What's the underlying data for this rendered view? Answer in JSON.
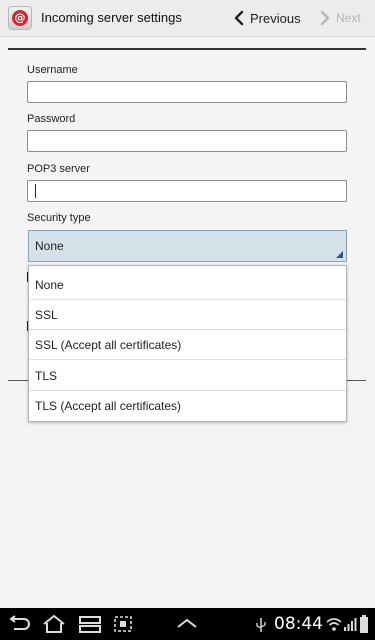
{
  "header": {
    "app_icon_glyph": "@",
    "title": "Incoming server settings",
    "previous_label": "Previous",
    "next_label": "Next"
  },
  "form": {
    "username_label": "Username",
    "username_value": "",
    "password_label": "Password",
    "password_value": "",
    "pop3_label": "POP3 server",
    "pop3_value": "",
    "security_label": "Security type",
    "security_value": "None"
  },
  "dropdown": {
    "options": [
      "None",
      "SSL",
      "SSL (Accept all certificates)",
      "TLS",
      "TLS (Accept all certificates)"
    ]
  },
  "status_bar": {
    "time": "08:44",
    "icons": [
      "back-icon",
      "home-icon",
      "recent-apps-icon",
      "screenshot-icon",
      "up-chevron-icon",
      "usb-icon",
      "wifi-icon",
      "signal-icon",
      "battery-icon"
    ]
  },
  "colors": {
    "accent_select_bg": "#d4e1e9",
    "app_icon_red": "#d2272e"
  }
}
